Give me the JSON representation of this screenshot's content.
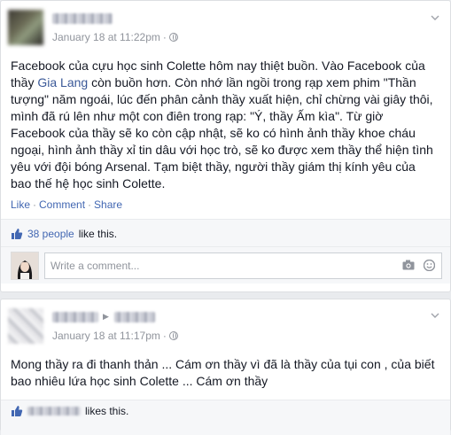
{
  "post1": {
    "author_name": "",
    "timestamp": "January 18 at 11:22pm",
    "separator": "·",
    "text_before_mention": "Facebook của cựu học sinh Colette hôm nay thiệt buồn. Vào Facebook của thầy ",
    "mention": "Gia Lang",
    "text_after_mention": " còn buồn hơn. Còn nhớ lần ngồi trong rạp xem phim \"Thần tượng\" năm ngoái, lúc đến phân cảnh thầy xuất hiện, chỉ chừng vài giây thôi, mình đã rú lên như một con điên trong rạp: \"Ý, thầy Ấm kìa\". Từ giờ Facebook của thầy sẽ ko còn cập nhật, sẽ ko có hình ảnh thầy khoe cháu ngoại, hình ảnh thầy xỉ tin dâu với học trò, sẽ ko được xem thầy thể hiện tình yêu với đội bóng Arsenal. Tạm biệt thầy, người thầy giám thị kính yêu của bao thế hệ học sinh Colette.",
    "actions": {
      "like": "Like",
      "comment": "Comment",
      "share": "Share",
      "sep": "·"
    },
    "likes": {
      "count_text": "38 people",
      "suffix": "like this."
    },
    "comment_placeholder": "Write a comment..."
  },
  "post2": {
    "timestamp": "January 18 at 11:17pm",
    "separator": "·",
    "text": "Mong thầy ra đi thanh thản ... Cám ơn thầy vì đã là thầy của tụi con , của biết bao nhiêu lứa học sinh Colette ... Cám ơn thầy",
    "likes": {
      "suffix": "likes this."
    }
  },
  "colors": {
    "link": "#4267b2",
    "meta": "#90949c",
    "text": "#141823",
    "border": "#dddfe2"
  },
  "icons": [
    "chevron-down-icon",
    "globe-icon",
    "thumbs-up-icon",
    "camera-icon",
    "sticker-icon",
    "play-triangle-icon"
  ]
}
